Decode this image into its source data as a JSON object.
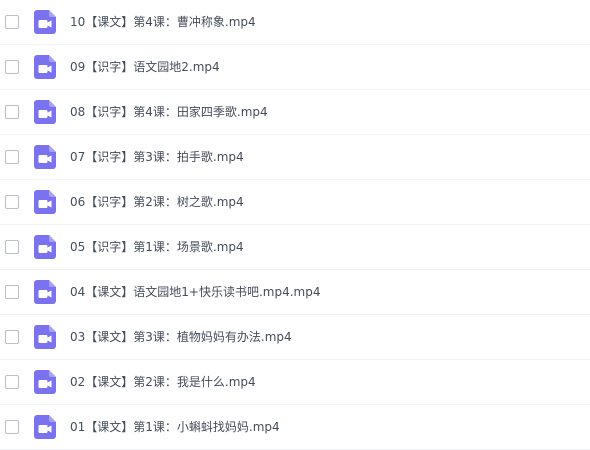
{
  "files": [
    {
      "name": "10【课文】第4课：曹冲称象.mp4",
      "icon": "video-file-icon"
    },
    {
      "name": "09【识字】语文园地2.mp4",
      "icon": "video-file-icon"
    },
    {
      "name": "08【识字】第4课：田家四季歌.mp4",
      "icon": "video-file-icon"
    },
    {
      "name": "07【识字】第3课：拍手歌.mp4",
      "icon": "video-file-icon"
    },
    {
      "name": "06【识字】第2课：树之歌.mp4",
      "icon": "video-file-icon"
    },
    {
      "name": "05【识字】第1课：场景歌.mp4",
      "icon": "video-file-icon"
    },
    {
      "name": "04【课文】语文园地1+快乐读书吧.mp4.mp4",
      "icon": "video-file-icon"
    },
    {
      "name": "03【课文】第3课：植物妈妈有办法.mp4",
      "icon": "video-file-icon"
    },
    {
      "name": "02【课文】第2课：我是什么.mp4",
      "icon": "video-file-icon"
    },
    {
      "name": "01【课文】第1课：小蝌蚪找妈妈.mp4",
      "icon": "video-file-icon"
    }
  ],
  "colors": {
    "icon_bg": "#7b72f0",
    "text": "#454d5a",
    "divider": "#f1f2f4"
  }
}
